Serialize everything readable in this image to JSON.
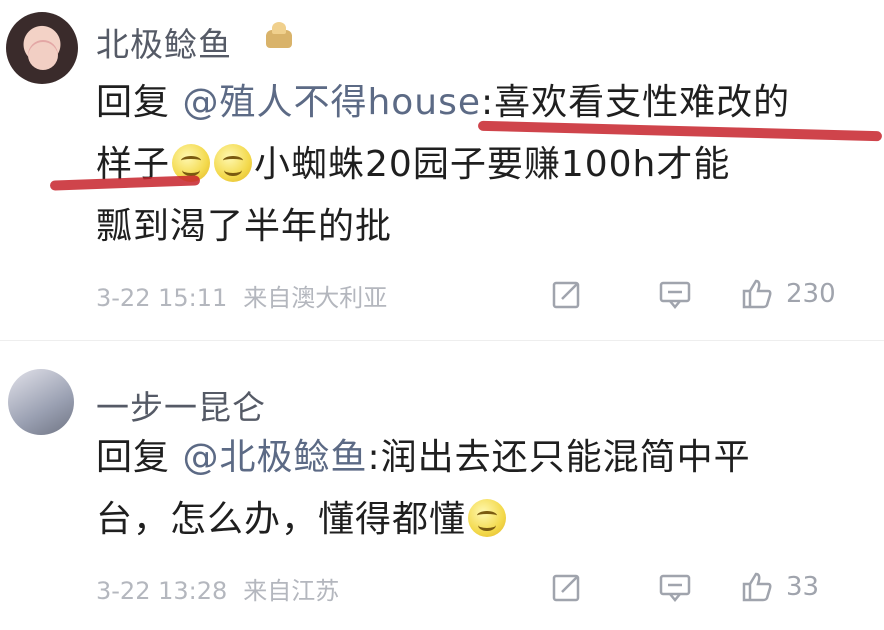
{
  "comments": [
    {
      "username": "北极鲶鱼",
      "reply_prefix": "回复 ",
      "mention": "@殖人不得house",
      "line1_rest": ":喜欢看支性难改的",
      "line2_a": "样子",
      "line2_b": "小蜘蛛20园子要赚100h才能",
      "line3": "瓢到渴了半年的批",
      "time": "3-22 15:11",
      "source": "来自澳大利亚",
      "likes": "230"
    },
    {
      "username": "一步一昆仑",
      "reply_prefix": "回复 ",
      "mention": "@北极鲶鱼",
      "line1_rest": ":润出去还只能混简中平",
      "line2": "台，怎么办，懂得都懂",
      "time": "3-22 13:28",
      "source": "来自江苏",
      "likes": "33"
    }
  ],
  "icons": {
    "edit": "edit-icon",
    "comment": "comment-icon",
    "like": "thumbs-up-icon",
    "emoji": "smile-emoji-icon",
    "badge": "crown-badge-icon"
  },
  "colors": {
    "mention": "#5c6a85",
    "meta": "#b4b7be",
    "underline": "#c7232b"
  }
}
